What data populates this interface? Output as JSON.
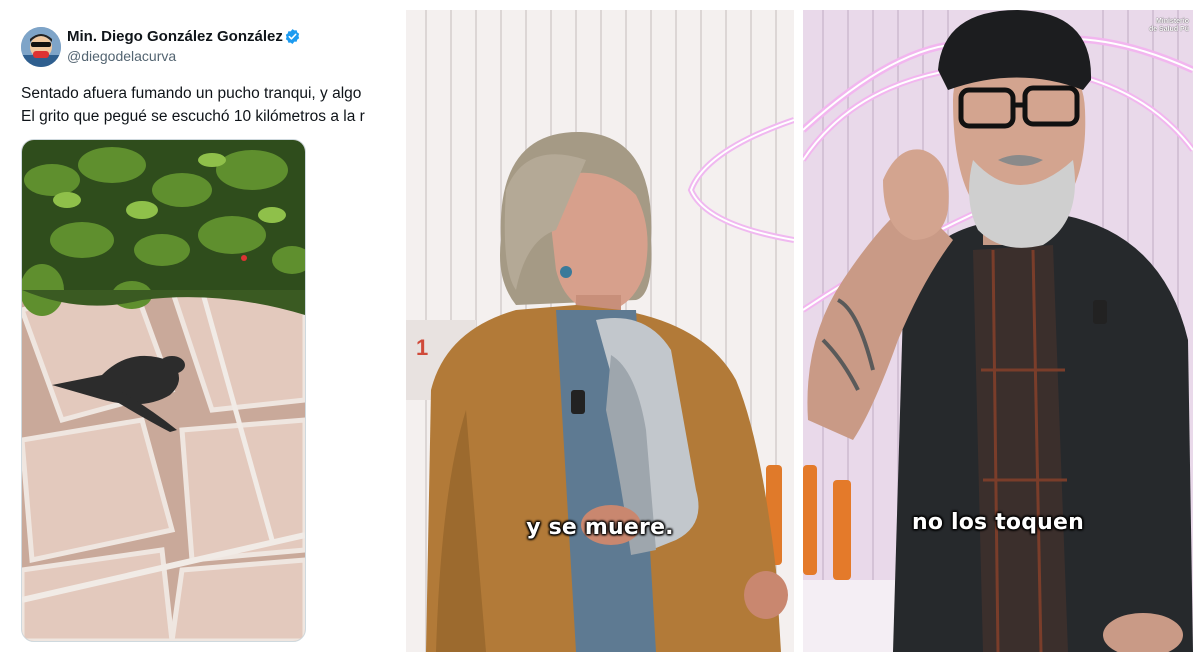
{
  "tweet": {
    "display_name": "Min. Diego González González",
    "handle": "@diegodelacurva",
    "text_lines": [
      "Sentado afuera fumando un pucho tranqui, y algo",
      "El grito que pegué se escuchó 10 kilómetros a la r"
    ],
    "avatar_icon": "avatar-cartoon-icon",
    "verified_icon": "verified-badge-icon",
    "verified_color": "#1d9bf0"
  },
  "videos": {
    "woman_subtitle": "y se muere.",
    "man_subtitle": "no los toquen",
    "watermark_lines": [
      "Ministerio",
      "de Salud Pú"
    ]
  }
}
